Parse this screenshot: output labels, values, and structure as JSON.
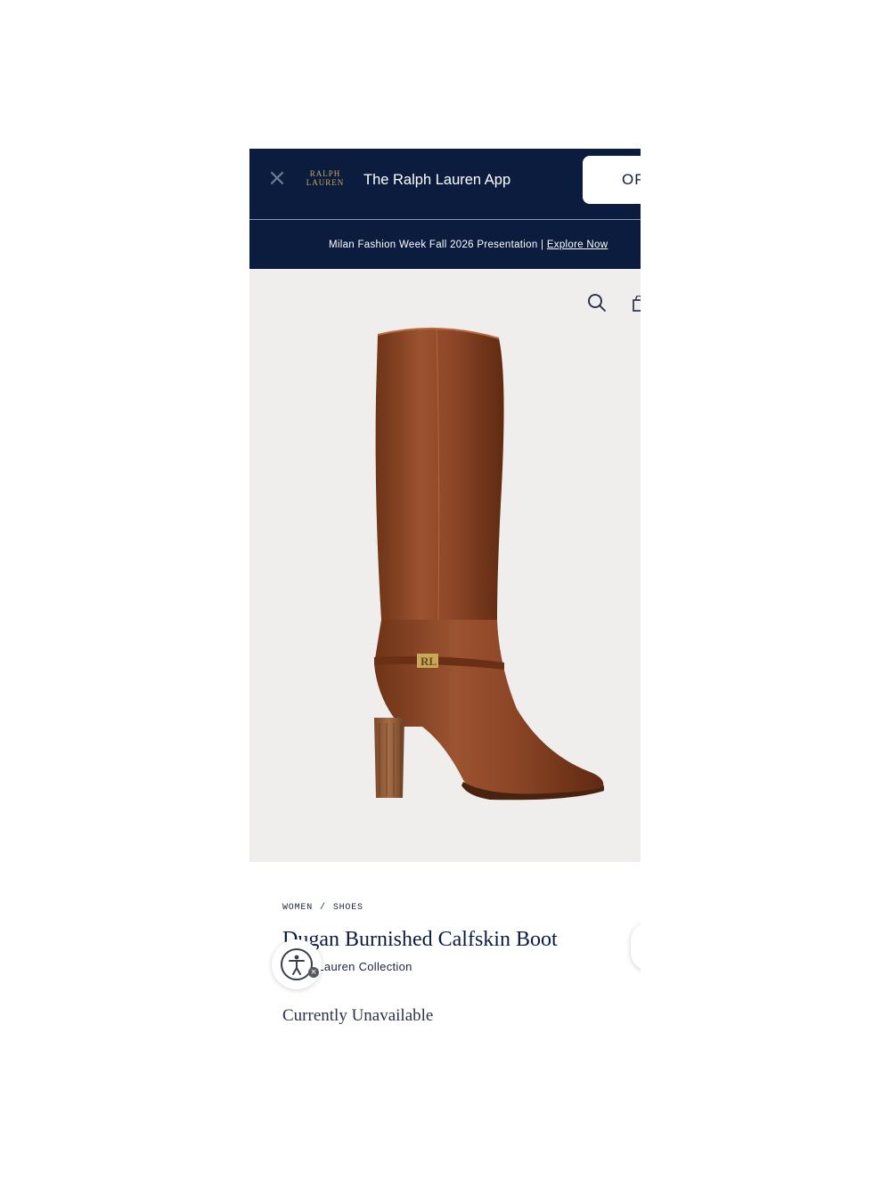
{
  "app_banner": {
    "close_icon": "close-icon",
    "logo_line1": "RALPH",
    "logo_line2": "LAUREN",
    "title": "The Ralph Lauren App",
    "open_label": "OPEN"
  },
  "promo": {
    "text": "Milan Fashion Week Fall 2026 Presentation | ",
    "link": "Explore Now"
  },
  "header_icons": {
    "search": "search-icon",
    "bag": "shopping-bag-icon"
  },
  "product": {
    "image": "brown-leather-knee-high-boot",
    "breadcrumb": {
      "level1": "WOMEN",
      "separator": "/",
      "level2": "SHOES"
    },
    "title": "Dugan Burnished Calfskin Boot",
    "collection": "Ralph Lauren Collection",
    "availability": "Currently Unavailable"
  },
  "accessibility": {
    "icon": "accessibility-icon",
    "dismiss": "×"
  },
  "colors": {
    "navy": "#0c1c3e",
    "gold": "#c9a85c",
    "product_bg": "#efeeec",
    "leather": "#8e4a2a"
  }
}
